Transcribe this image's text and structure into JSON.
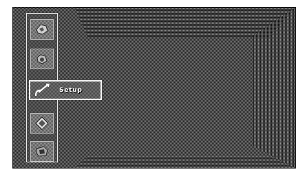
{
  "menu": {
    "items": [
      {
        "icon": "picture-icon",
        "selected": false
      },
      {
        "icon": "sound-icon",
        "selected": false
      },
      {
        "icon": "setup-icon",
        "label": "Setup",
        "selected": true
      },
      {
        "icon": "features-icon",
        "selected": false
      },
      {
        "icon": "channel-icon",
        "selected": false
      }
    ]
  }
}
